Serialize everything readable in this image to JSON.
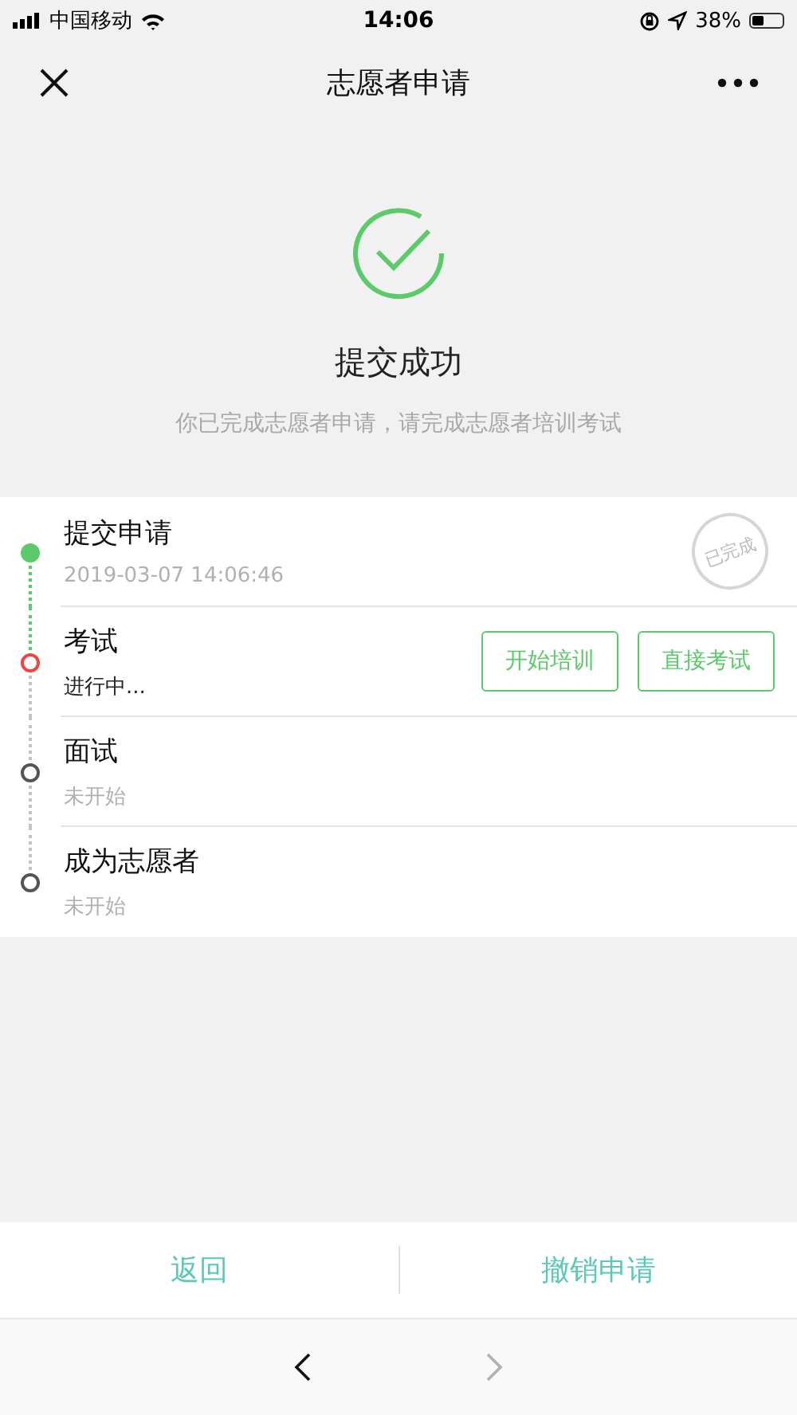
{
  "status_bar": {
    "carrier": "中国移动",
    "time": "14:06",
    "battery": "38%"
  },
  "nav": {
    "title": "志愿者申请"
  },
  "result": {
    "title": "提交成功",
    "message": "你已完成志愿者申请，请完成志愿者培训考试"
  },
  "steps": [
    {
      "kind": "done",
      "title": "提交申请",
      "detail": "2019-03-07 14:06:46",
      "stamp": "已完成"
    },
    {
      "kind": "active",
      "title": "考试",
      "detail": "进行中...",
      "buttons": [
        "开始培训",
        "直接考试"
      ]
    },
    {
      "kind": "pending",
      "title": "面试",
      "detail": "未开始"
    },
    {
      "kind": "pending",
      "title": "成为志愿者",
      "detail": "未开始"
    }
  ],
  "actions": [
    "返回",
    "撤销申请"
  ],
  "browser_nav": {
    "back_disabled": false,
    "forward_disabled": true
  }
}
